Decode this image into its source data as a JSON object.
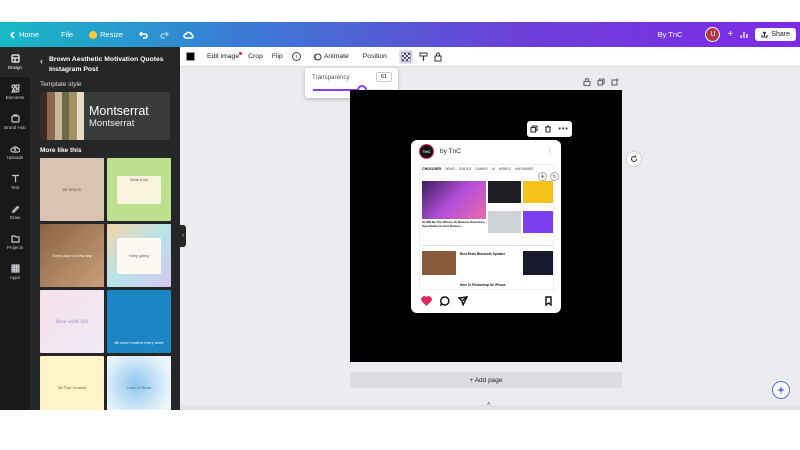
{
  "topbar": {
    "home": "Home",
    "file": "File",
    "resize": "Resize",
    "doc_title": "By TnC",
    "avatar_letter": "U",
    "share": "Share"
  },
  "rail": {
    "items": [
      "Design",
      "Elements",
      "Brand Hub",
      "Uploads",
      "Text",
      "Draw",
      "Projects",
      "Apps"
    ]
  },
  "panel": {
    "title": "Brown Aesthetic Motivation Quotes Instagram Post",
    "template_style": "Template style",
    "font_primary": "Montserrat",
    "font_secondary": "Montserrat",
    "more_like_this": "More like this",
    "swatches": [
      "#3b2a20",
      "#8a6a4e",
      "#c9b79a",
      "#6f6a45",
      "#a39468",
      "#e8dcc6"
    ],
    "thumbs": [
      {
        "bg": "#d9c4b4",
        "caption": "BE BRAVE"
      },
      {
        "bg": "#bde08e",
        "caption": "Write a list"
      },
      {
        "bg": "#b08a67",
        "caption": "Every day is a new day"
      },
      {
        "bg": "#c8e0ef",
        "caption": "Keep going"
      },
      {
        "bg": "#f3e7ee",
        "caption": "flow with life"
      },
      {
        "bg": "#1c86c4",
        "caption": "Be more creative every week"
      },
      {
        "bg": "#fff4c8",
        "caption": "Be True Yourself"
      },
      {
        "bg": "#c6e3f7",
        "caption": "Learn to Relax"
      }
    ]
  },
  "toolbar": {
    "edit_image": "Edit image",
    "crop": "Crop",
    "flip": "Flip",
    "info": "i",
    "animate": "Animate",
    "position": "Position"
  },
  "transparency": {
    "label": "Transparency",
    "value": "61",
    "fraction": 0.61
  },
  "card": {
    "brand": "by TnC",
    "logo_text": "TnC",
    "site_name": "CHOOSER",
    "nav": [
      "NEWS",
      "GUIDES",
      "GAMING",
      "AI",
      "MOBILE",
      "HARDWARE"
    ],
    "headline_1": "AI Will Be The iPhone 15 Release Date Price, Specifications And Rumors",
    "headline_2": "Best Retro Bluetooth Speaker",
    "headline_3": "How To Photoshop On iPhone"
  },
  "canvas": {
    "add_page": "+ Add page"
  }
}
